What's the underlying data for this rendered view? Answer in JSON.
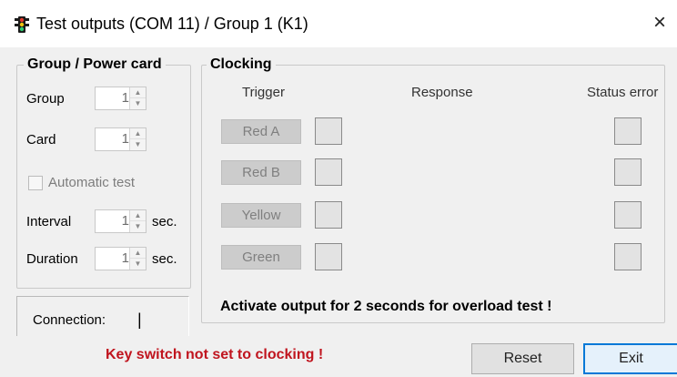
{
  "window": {
    "title": "Test outputs (COM 11) / Group 1 (K1)",
    "close_glyph": "×",
    "icon": "traffic-light-icon"
  },
  "group_panel": {
    "legend": "Group / Power card",
    "group_label": "Group",
    "group_value": "1",
    "card_label": "Card",
    "card_value": "1",
    "automatic_test_label": "Automatic test",
    "automatic_test_checked": false,
    "interval_label": "Interval",
    "interval_value": "1",
    "interval_unit": "sec.",
    "duration_label": "Duration",
    "duration_value": "1",
    "duration_unit": "sec."
  },
  "clocking_panel": {
    "legend": "Clocking",
    "col_trigger": "Trigger",
    "col_response": "Response",
    "col_status_error": "Status error",
    "outputs": [
      {
        "label": "Red A"
      },
      {
        "label": "Red B"
      },
      {
        "label": "Yellow"
      },
      {
        "label": "Green"
      }
    ],
    "note": "Activate output for 2 seconds for overload test !"
  },
  "connection": {
    "label": "Connection:",
    "value": "|"
  },
  "warning": "Key switch not set to clocking !",
  "buttons": {
    "reset": "Reset",
    "exit": "Exit"
  },
  "colors": {
    "warning_text": "#c0141e",
    "exit_button_border": "#0078d7",
    "disabled_button": "#cccccc"
  },
  "spinner_icons": {
    "up": "▲",
    "down": "▼"
  }
}
